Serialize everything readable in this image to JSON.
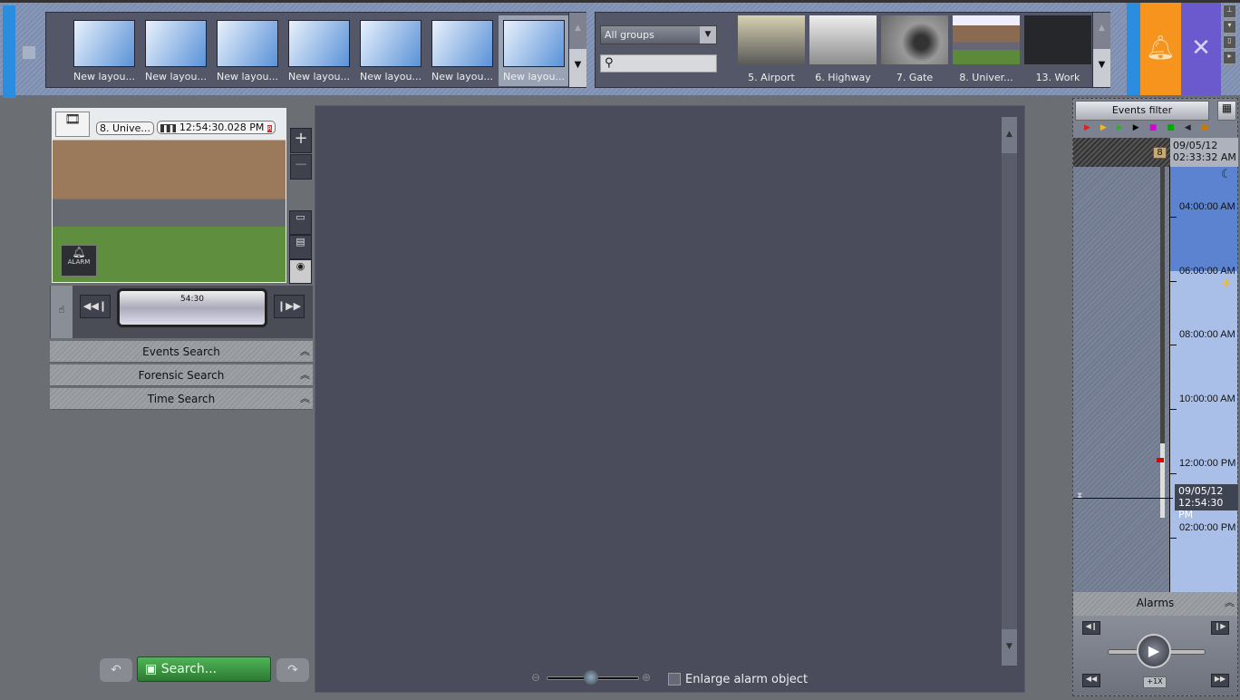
{
  "layouts": {
    "items": [
      {
        "label": "New layou..."
      },
      {
        "label": "New layou..."
      },
      {
        "label": "New layou..."
      },
      {
        "label": "New layou..."
      },
      {
        "label": "New layou..."
      },
      {
        "label": "New layou..."
      },
      {
        "label": "New layou...",
        "selected": true
      }
    ]
  },
  "cameras": {
    "group_select": "All groups",
    "search_placeholder": "",
    "items": [
      {
        "label": "5. Airport"
      },
      {
        "label": "6. Highway"
      },
      {
        "label": "7. Gate"
      },
      {
        "label": "8. Univer..."
      },
      {
        "label": "13. Work"
      }
    ]
  },
  "video": {
    "camera_name": "8. Unive...",
    "timestamp": "12:54:30.028 PM",
    "alarm_label": "ALARM",
    "scrub_time": "54:30"
  },
  "accordion": {
    "events": "Events Search",
    "forensic": "Forensic Search",
    "time": "Time Search"
  },
  "search_button": "Search...",
  "viewer": {
    "enlarge_label": "Enlarge alarm object",
    "enlarge_checked": false
  },
  "timeline": {
    "filter_label": "Events filter",
    "camera_badge": "8",
    "start_date": "09/05/12",
    "start_time": "02:33:32 AM",
    "labels": [
      "04:00:00 AM",
      "06:00:00 AM",
      "08:00:00 AM",
      "10:00:00 AM",
      "12:00:00 PM",
      "02:00:00 PM"
    ],
    "current_date": "09/05/12",
    "current_time": "12:54:30 PM"
  },
  "alarms": {
    "title": "Alarms",
    "speed": "+1X"
  },
  "colors": {
    "alarm": "#f7941d",
    "settings": "#6a5acd",
    "accent_blue": "#2b8de0",
    "search_green": "#3a9a42"
  }
}
